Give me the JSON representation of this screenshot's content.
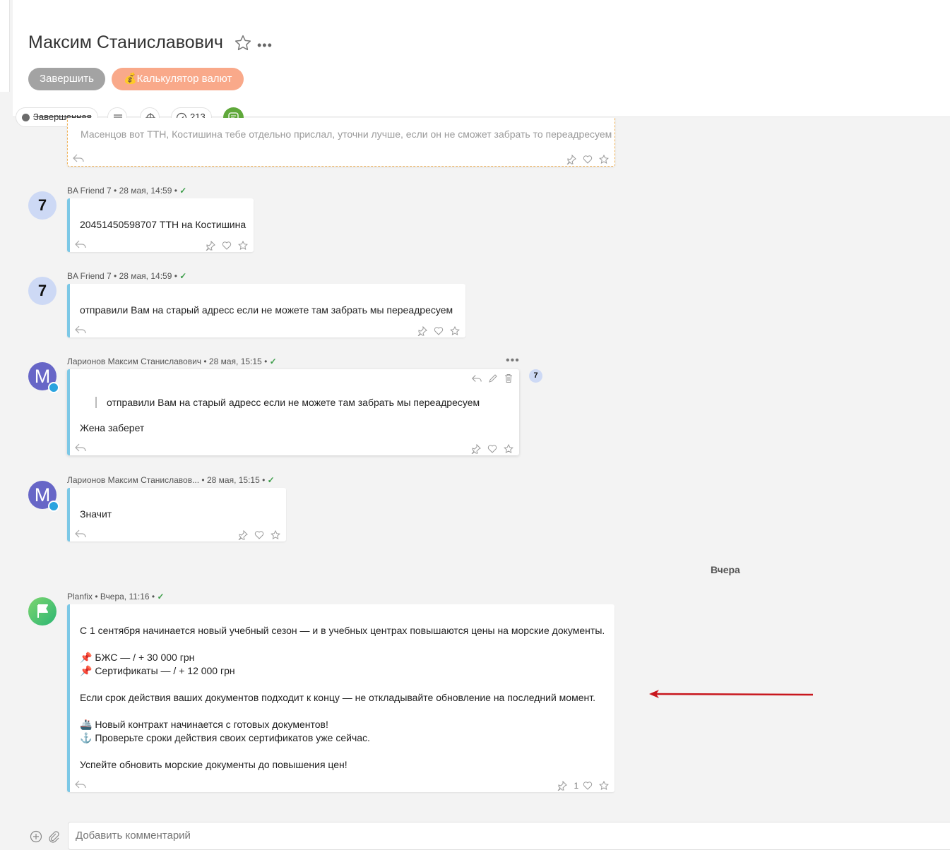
{
  "task": {
    "title": "Максим Станиславович",
    "finish_label": "Завершить",
    "calc_label": "💰Калькулятор валют",
    "status_label": "Завершенная",
    "comments_count": "213"
  },
  "messages": [
    {
      "text": "Масенцов вот ТТН, Костишина тебе отдельно прислал, уточни лучше, если он не сможет забрать то переадресуем"
    },
    {
      "avatar": "7",
      "author": "BA Friend 7",
      "time": "28 мая, 14:59",
      "text": "20451450598707 ТТН на Костишина"
    },
    {
      "avatar": "7",
      "author": "BA Friend 7",
      "time": "28 мая, 14:59",
      "text": "отправили Вам на старый адресс если не можете там забрать мы переадресуем"
    },
    {
      "avatar": "M",
      "author": "Ларионов Максим Станиславович",
      "time": "28 мая, 15:15",
      "quote": "отправили Вам на старый адресс если не можете там забрать мы переадресуем",
      "text": "Жена заберет",
      "badge": "7"
    },
    {
      "avatar": "M",
      "author": "Ларионов Максим Станиславов...",
      "time": "28 мая, 15:15",
      "text": "Значит"
    },
    {
      "author": "Planfix",
      "time": "Вчера, 11:16",
      "lines": [
        "С 1 сентября начинается новый учебный сезон — и в учебных центрах повышаются цены на морские документы.",
        "📌 БЖС — / + 30 000 грн",
        "📌 Сертификаты — / + 12 000 грн",
        "Если срок действия ваших документов подходит к концу — не откладывайте обновление на последний момент.",
        "🚢 Новый контракт начинается с готовых документов!",
        "⚓ Проверьте сроки действия своих сертификатов уже сейчас.",
        "Успейте обновить морские документы до повышения цен!"
      ],
      "likes": "1"
    }
  ],
  "day_separator": "Вчера",
  "comment_input": {
    "placeholder": "Добавить комментарий"
  },
  "colors": {
    "accent_blue": "#7cc8e6",
    "calc_button": "#f9a98a",
    "finish_button": "#a3a3a3",
    "arrow": "#c8161d"
  }
}
